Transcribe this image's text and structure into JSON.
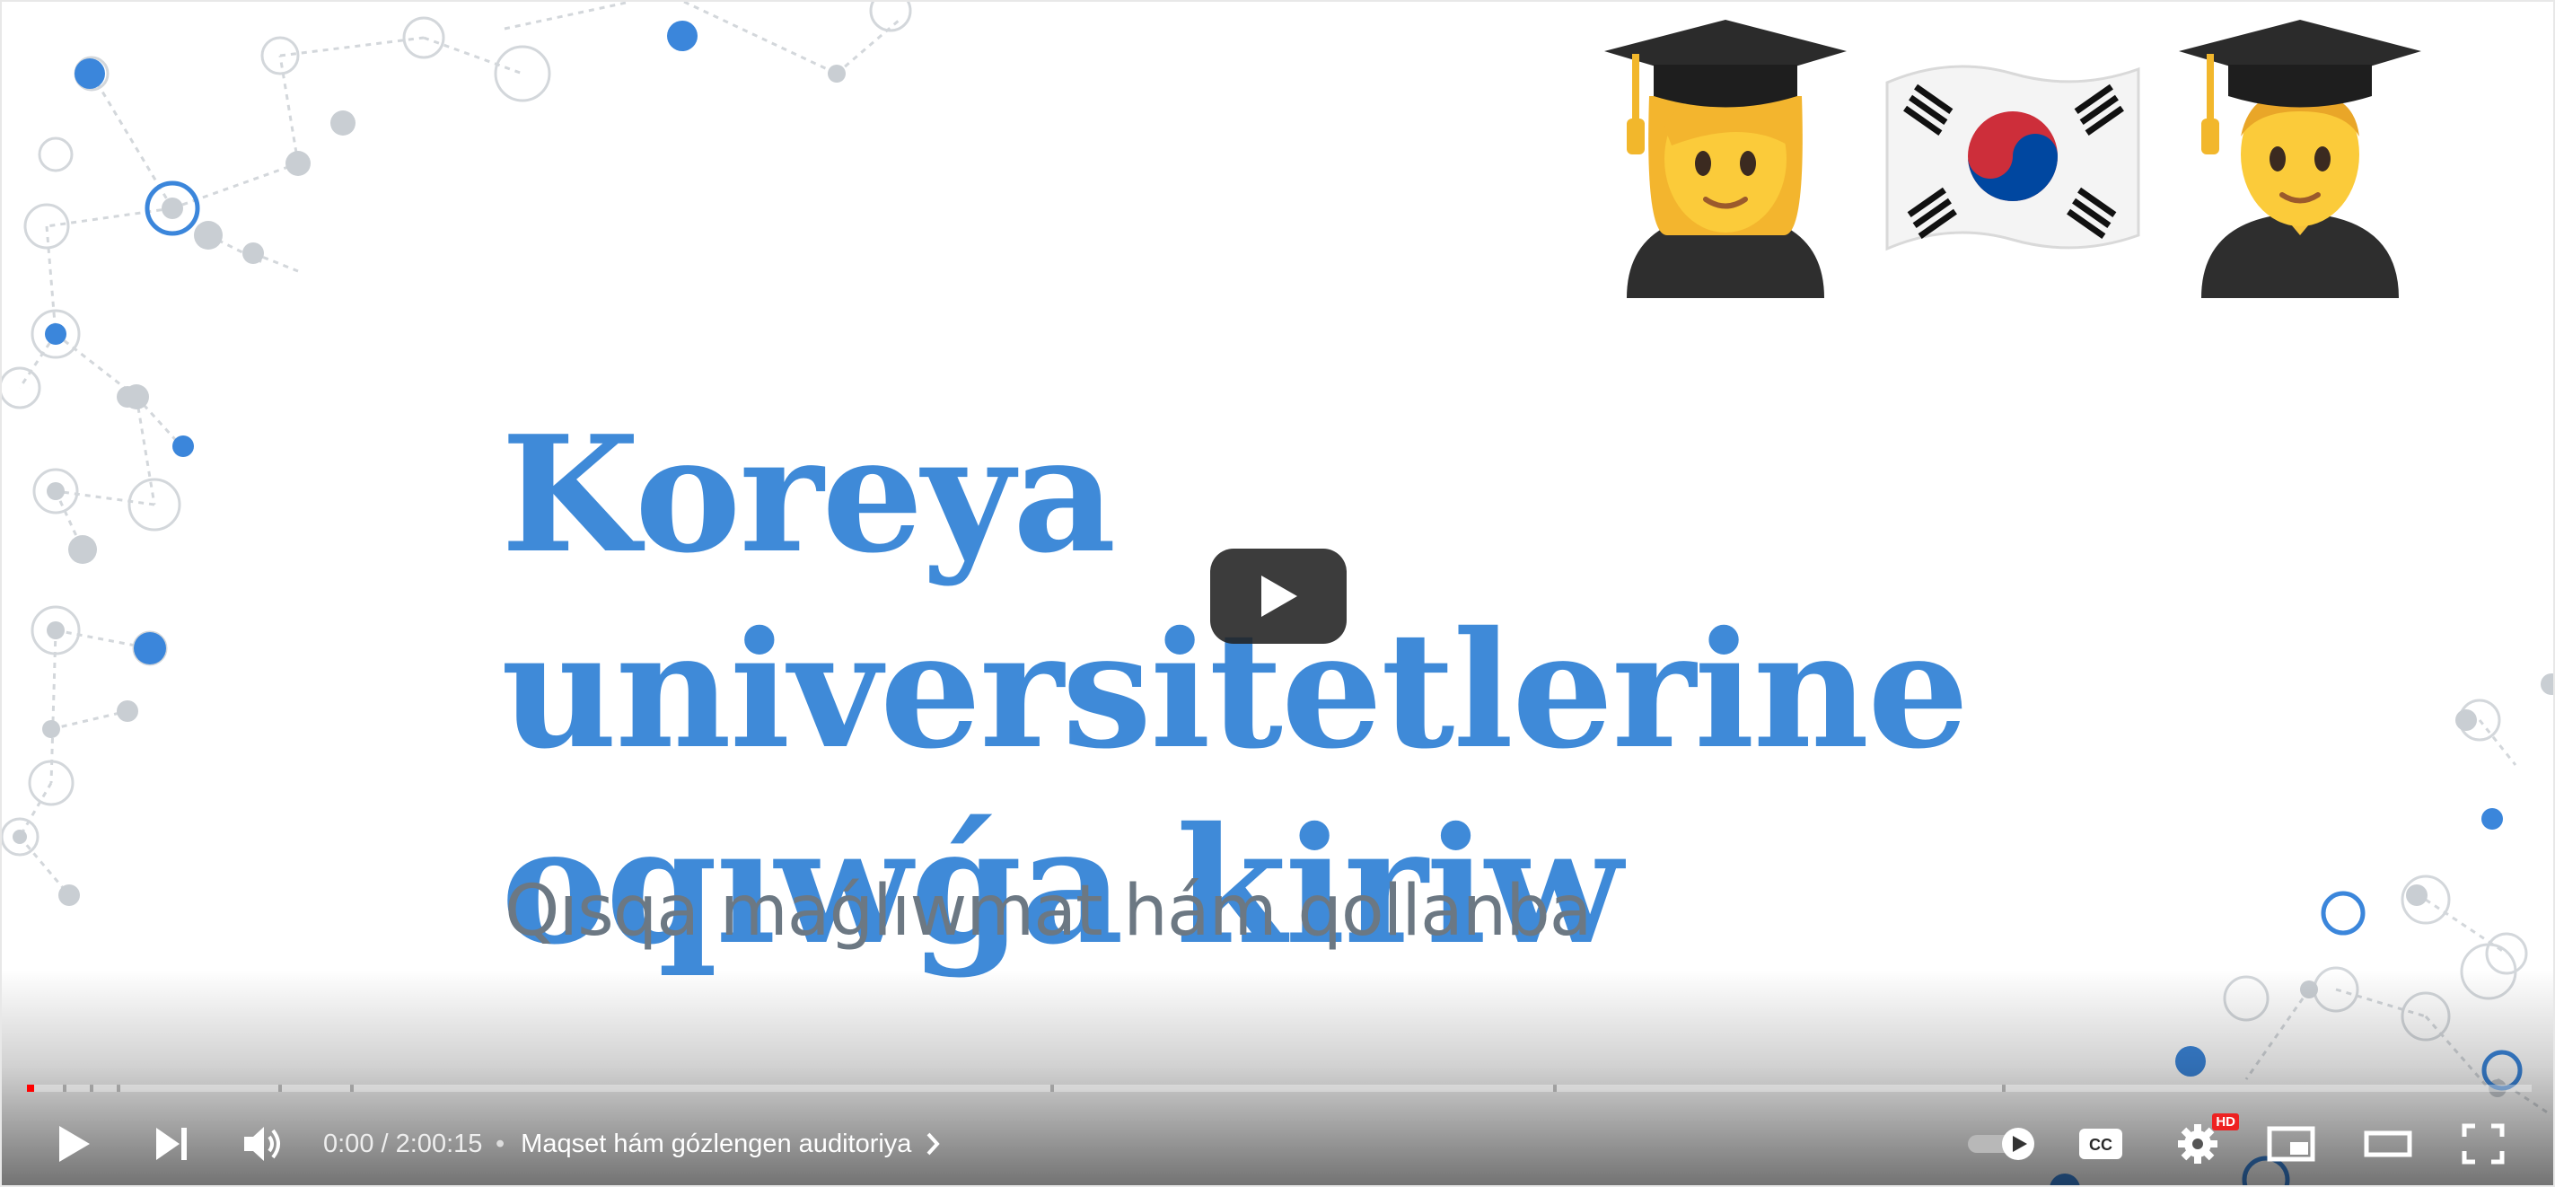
{
  "slide": {
    "title_line1": "Koreya universitetlerine",
    "title_line2": "oqıwǵa kiriw",
    "subtitle": "Qısqa maǵlıwmat hám qollanba"
  },
  "emojis": [
    "female-graduate",
    "south-korea-flag",
    "male-graduate"
  ],
  "player": {
    "time_current": "0:00",
    "time_separator": " / ",
    "time_total": "2:00:15",
    "chapter_separator": "•",
    "chapter_title": "Maqset hám gózlengen auditoriya",
    "hd_badge": "HD",
    "progress_fraction": 0.003,
    "icons": {
      "big_play": "play-icon",
      "play": "play-icon",
      "next": "next-icon",
      "volume": "volume-icon",
      "autoplay": "autoplay-toggle-icon",
      "captions": "captions-icon",
      "settings": "gear-icon",
      "miniplayer": "miniplayer-icon",
      "theater": "theater-icon",
      "fullscreen": "fullscreen-icon"
    }
  },
  "colors": {
    "title_blue": "#3f8ad8",
    "subtitle_gray": "#6c7883",
    "progress_red": "#ff0000",
    "network_blue": "#3b86db",
    "network_gray": "#c9ced3"
  }
}
